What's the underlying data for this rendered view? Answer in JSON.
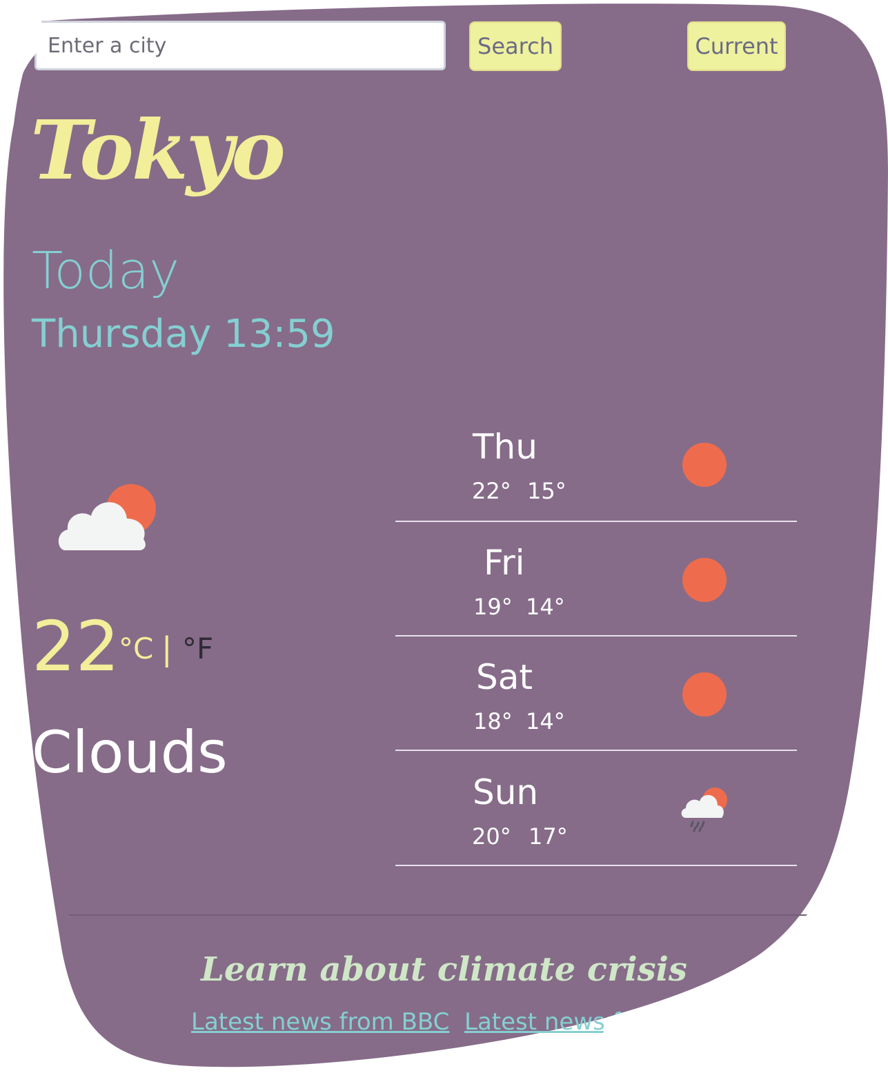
{
  "search": {
    "placeholder": "Enter a city",
    "search_label": "Search",
    "current_label": "Current"
  },
  "header": {
    "city": "Tokyo",
    "today_label": "Today",
    "date_time": "Thursday 13:59"
  },
  "current": {
    "icon": "partly-cloudy-icon",
    "temperature": "22",
    "unit_c": "°C",
    "separator": "|",
    "unit_f": "°F",
    "description": "Clouds"
  },
  "forecast": [
    {
      "day": "Thu",
      "max": "22°",
      "min": "15°",
      "icon": "sun-icon"
    },
    {
      "day": "Fri",
      "max": "19°",
      "min": "14°",
      "icon": "sun-icon"
    },
    {
      "day": "Sat",
      "max": "18°",
      "min": "14°",
      "icon": "sun-icon"
    },
    {
      "day": "Sun",
      "max": "20°",
      "min": "17°",
      "icon": "rain-cloud-sun-icon"
    }
  ],
  "footer": {
    "title": "Learn about climate crisis",
    "links": [
      "Latest news from BBC",
      "Latest news from"
    ]
  },
  "colors": {
    "panel": "#866c89",
    "accent_yellow": "#f2ee9a",
    "accent_teal": "#85cfd2",
    "sun": "#ee6c4d"
  }
}
